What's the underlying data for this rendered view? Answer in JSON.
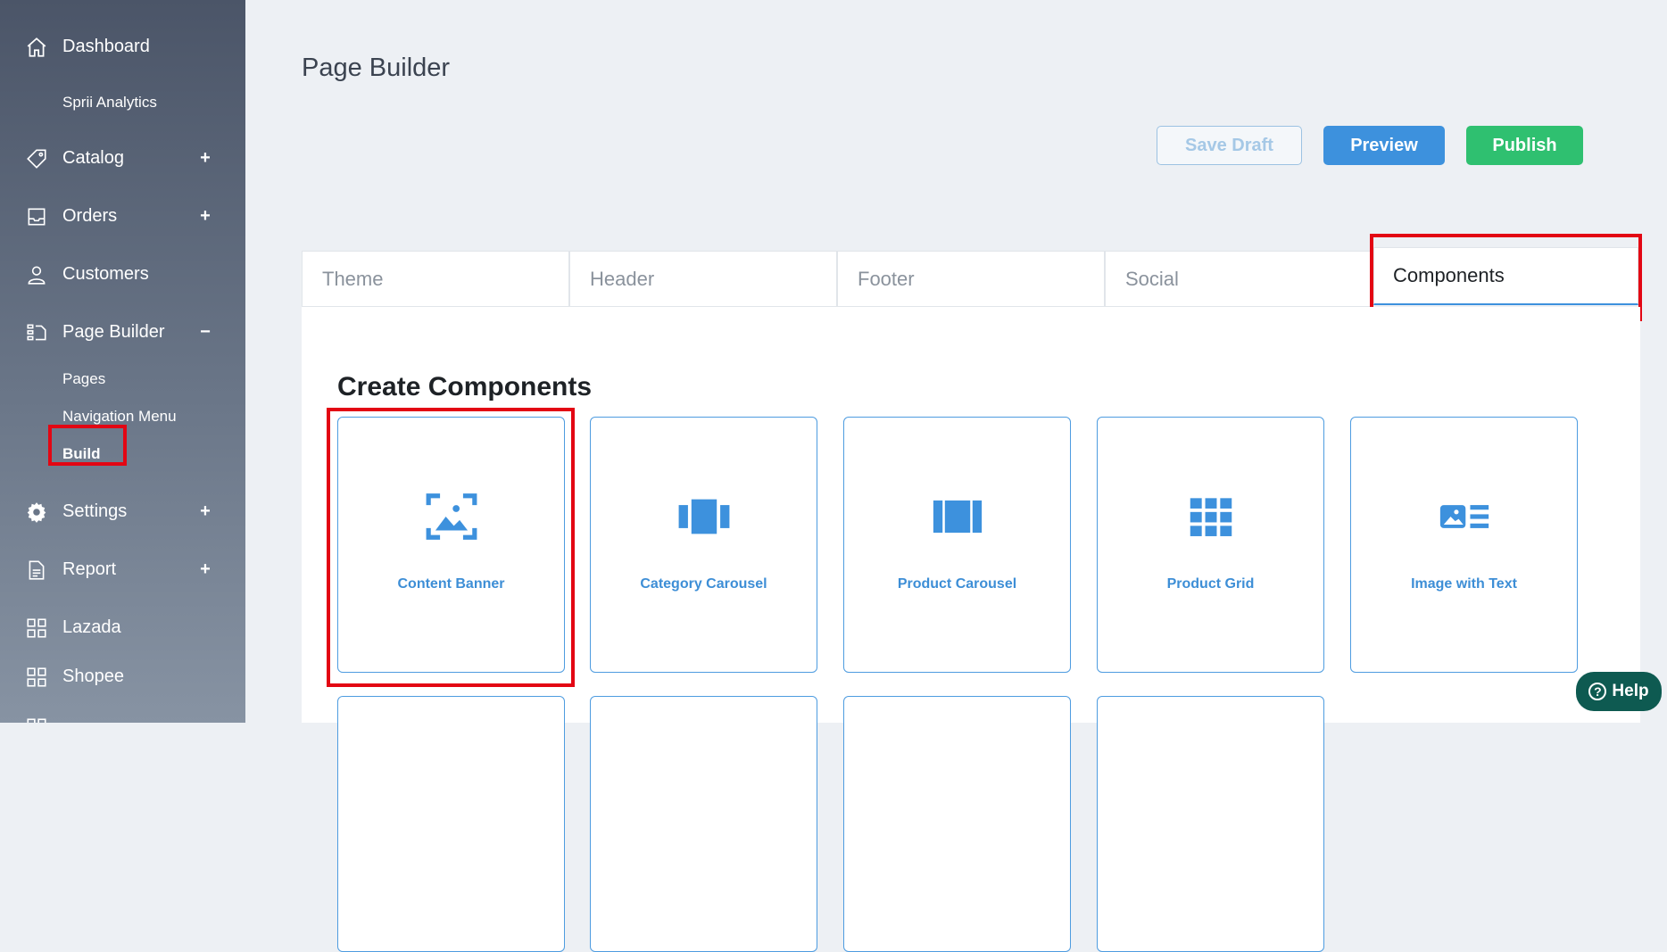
{
  "sidebar": {
    "items": [
      {
        "label": "Dashboard",
        "icon": "home-icon"
      },
      {
        "label": "Sprii Analytics"
      },
      {
        "label": "Catalog",
        "icon": "tag-icon",
        "toggle": "+"
      },
      {
        "label": "Orders",
        "icon": "inbox-icon",
        "toggle": "+"
      },
      {
        "label": "Customers",
        "icon": "user-icon"
      },
      {
        "label": "Page Builder",
        "icon": "page-builder-icon",
        "toggle": "−"
      },
      {
        "label": "Settings",
        "icon": "gear-icon",
        "toggle": "+"
      },
      {
        "label": "Report",
        "icon": "document-icon",
        "toggle": "+"
      },
      {
        "label": "Lazada",
        "icon": "grid-icon"
      },
      {
        "label": "Shopee",
        "icon": "grid-icon"
      }
    ],
    "page_builder_sub": [
      "Pages",
      "Navigation Menu",
      "Build"
    ]
  },
  "main": {
    "title": "Page Builder",
    "buttons": {
      "save_draft": "Save Draft",
      "preview": "Preview",
      "publish": "Publish"
    },
    "tabs": [
      "Theme",
      "Header",
      "Footer",
      "Social",
      "Components"
    ],
    "active_tab": "Components",
    "section_title": "Create Components",
    "components": [
      {
        "label": "Content Banner",
        "icon": "image-frame-icon"
      },
      {
        "label": "Category Carousel",
        "icon": "carousel-icon"
      },
      {
        "label": "Product Carousel",
        "icon": "columns-icon"
      },
      {
        "label": "Product Grid",
        "icon": "grid-icon"
      },
      {
        "label": "Image with Text",
        "icon": "image-text-icon"
      }
    ]
  },
  "help": {
    "label": "Help"
  },
  "colors": {
    "accent": "#3d91dd",
    "publish": "#2fc070",
    "highlight": "#e30613",
    "help": "#0e5a51"
  }
}
